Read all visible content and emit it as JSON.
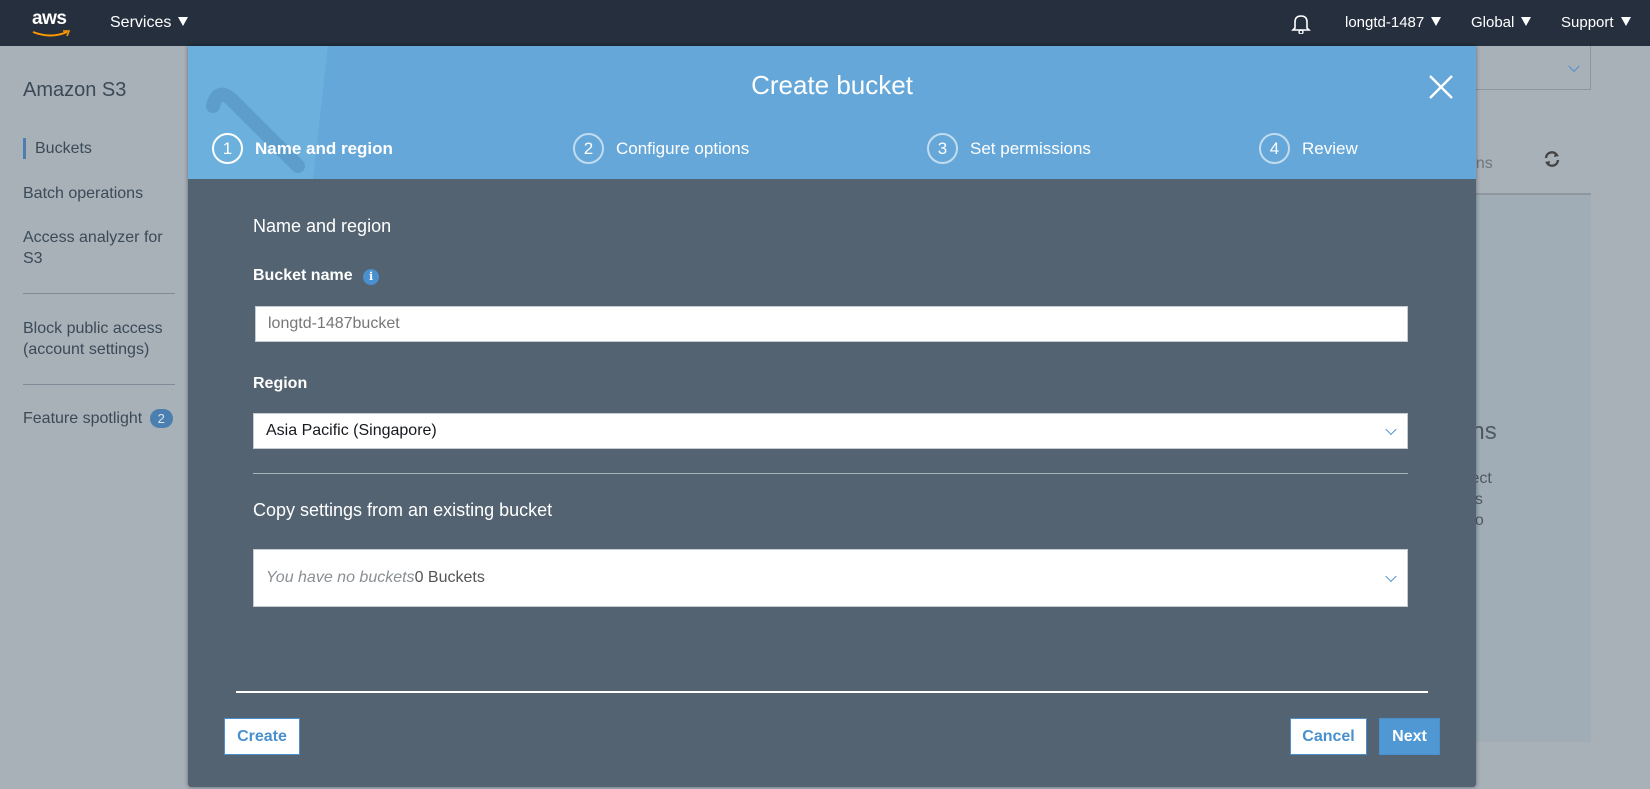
{
  "topbar": {
    "logo": "aws",
    "services": "Services",
    "account": "longtd-1487",
    "region": "Global",
    "support": "Support"
  },
  "sidebar": {
    "title": "Amazon S3",
    "items": [
      {
        "label": "Buckets"
      },
      {
        "label": "Batch operations"
      },
      {
        "label": "Access analyzer for S3"
      },
      {
        "label": "Block public access (account settings)"
      },
      {
        "label": "Feature spotlight",
        "badge": "2"
      }
    ]
  },
  "background": {
    "tab_fragment": "ons",
    "heading_fragment": "ons",
    "text_lines": [
      "bject",
      "ess",
      "s to"
    ]
  },
  "modal": {
    "title": "Create bucket",
    "steps": [
      {
        "num": "1",
        "label": "Name and region"
      },
      {
        "num": "2",
        "label": "Configure options"
      },
      {
        "num": "3",
        "label": "Set permissions"
      },
      {
        "num": "4",
        "label": "Review"
      }
    ],
    "section_title": "Name and region",
    "bucket_name_label": "Bucket name",
    "bucket_name_value": "longtd-1487bucket",
    "region_label": "Region",
    "region_value": "Asia Pacific (Singapore)",
    "copy_title": "Copy settings from an existing bucket",
    "copy_placeholder": "You have no buckets",
    "copy_count": "0 Buckets",
    "create": "Create",
    "cancel": "Cancel",
    "next": "Next"
  },
  "colors": {
    "header": "#65a7d8",
    "body": "#536371",
    "accent": "#4a90cf",
    "topbar": "#252f3e"
  }
}
